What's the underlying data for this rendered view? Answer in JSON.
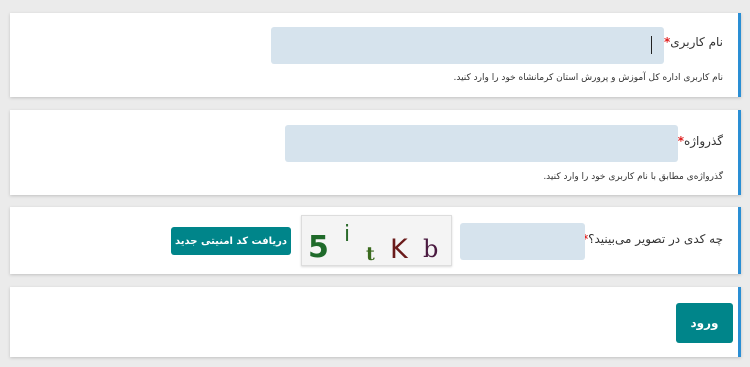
{
  "username": {
    "label": "نام کاربری",
    "required_mark": "*",
    "value": "",
    "hint": "نام کاربری اداره کل آموزش و پرورش استان کرمانشاه خود را وارد کنید."
  },
  "password": {
    "label": "گذرواژه",
    "required_mark": "*",
    "value": "",
    "hint": "گذرواژه‌ی مطابق با نام کاربری خود را وارد کنید."
  },
  "captcha": {
    "label": "چه کدی در تصویر می‌بینید؟",
    "required_mark": "*",
    "value": "",
    "refresh_label": "دریافت کد امنیتی جدید",
    "image_chars": [
      "5",
      "i",
      "t",
      "K",
      "b"
    ]
  },
  "login": {
    "button_label": "ورود"
  },
  "colors": {
    "accent": "#2a8ed4",
    "button": "#00858a",
    "field": "#d6e3ed",
    "required": "#e02020"
  }
}
